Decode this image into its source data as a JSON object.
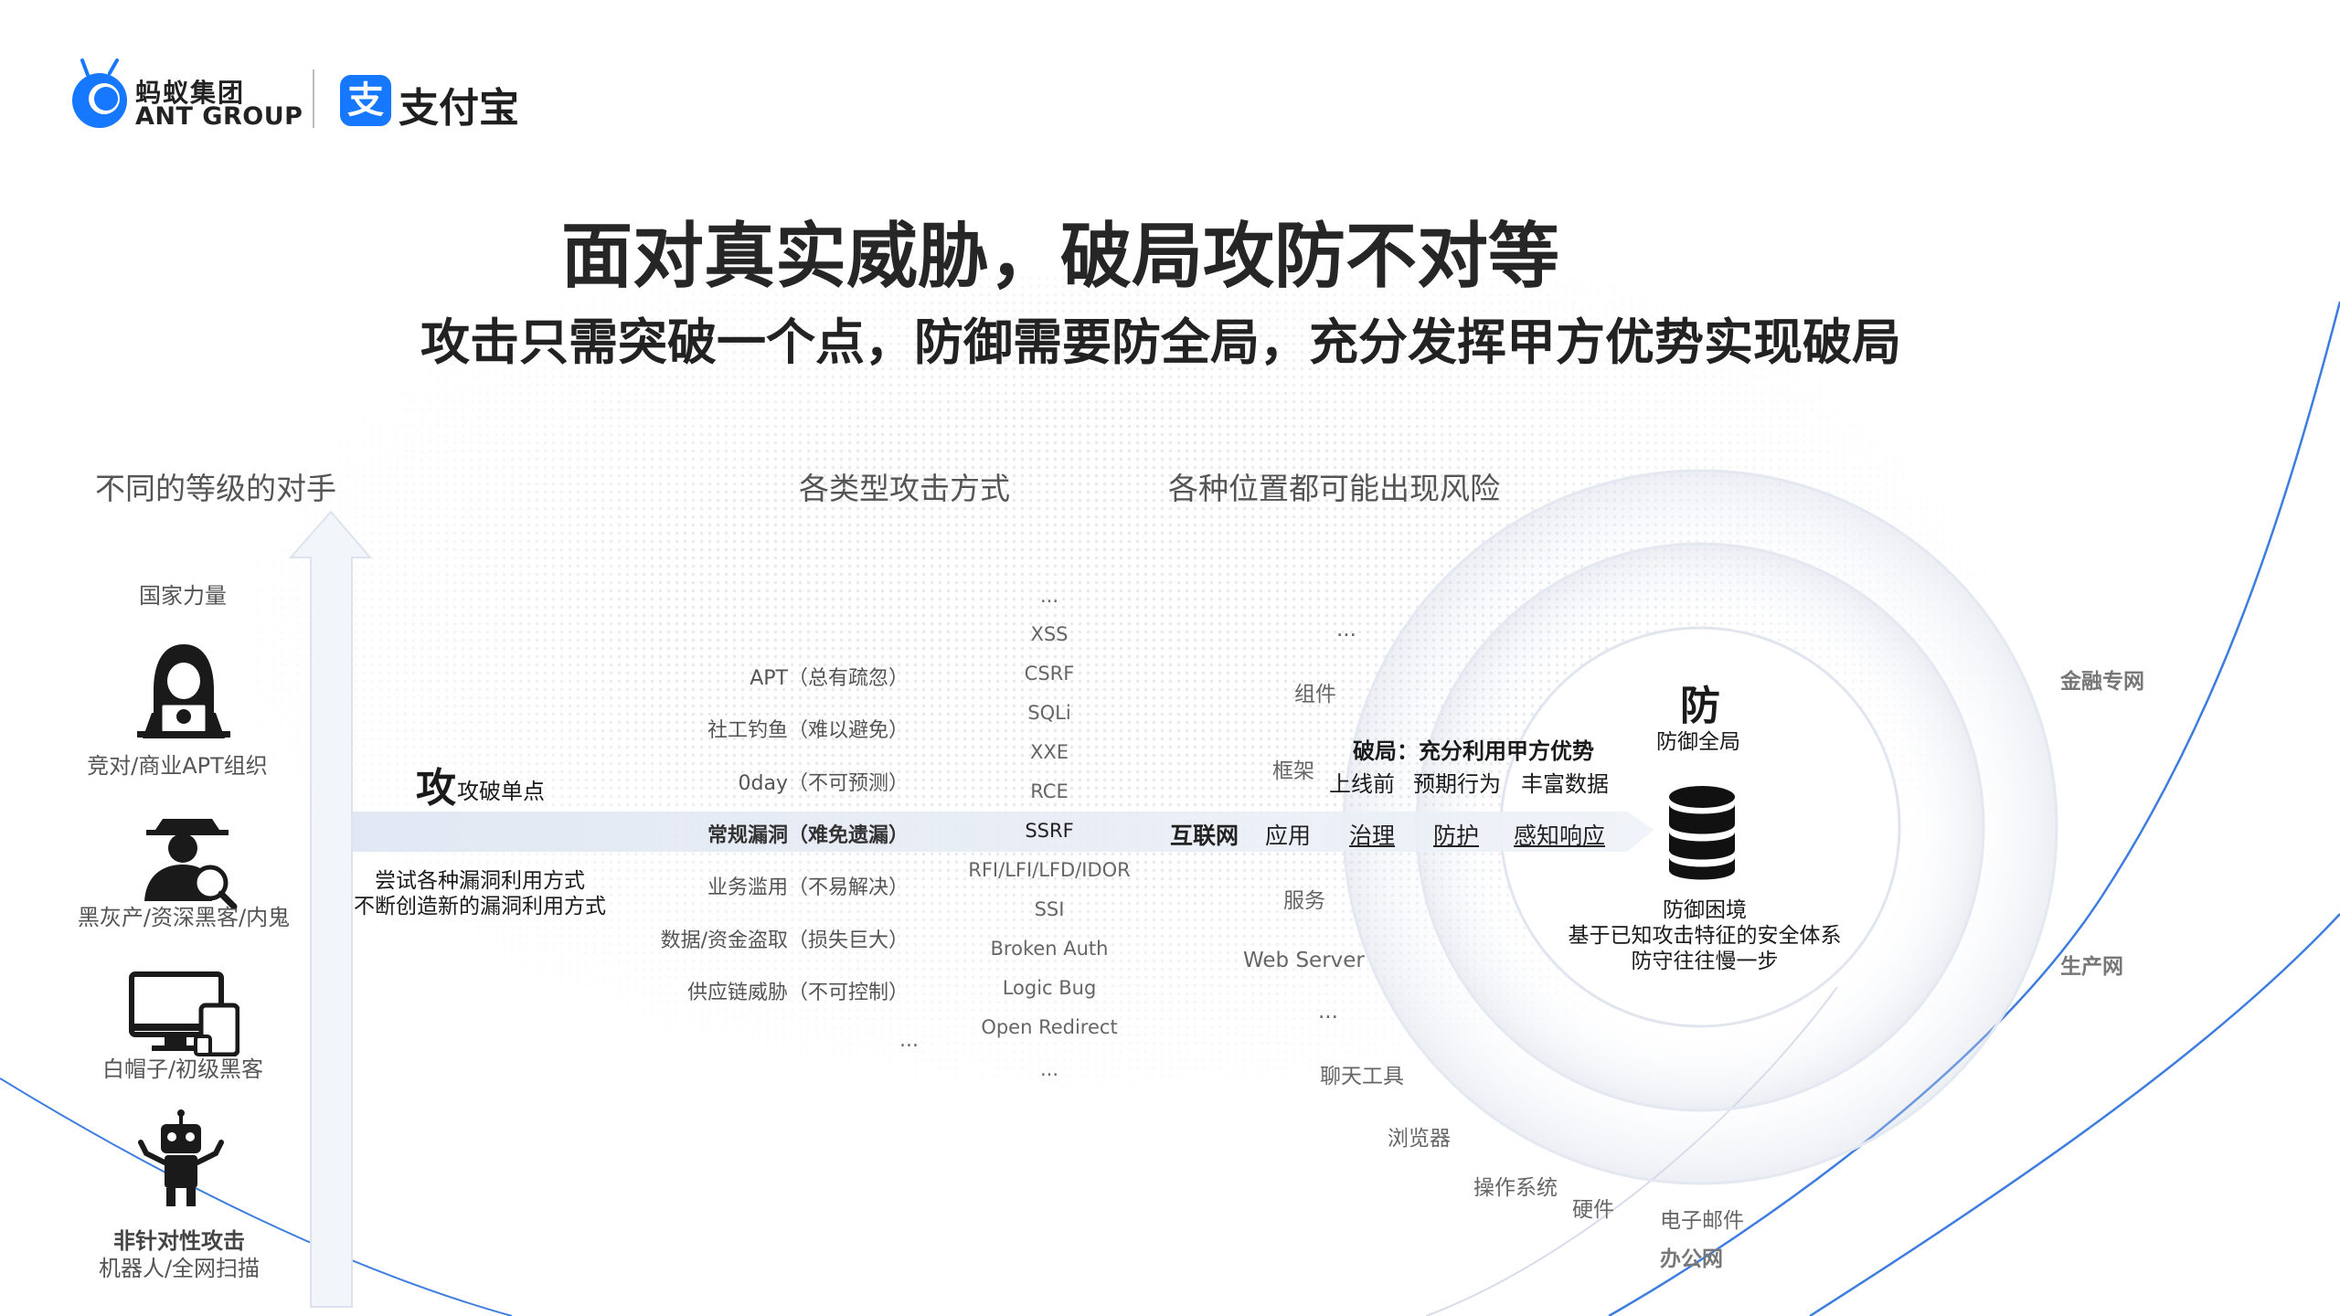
{
  "brand": {
    "ant_cn": "蚂蚁集团",
    "ant_en": "ANT GROUP",
    "alipay_mark": "支",
    "alipay_name": "支付宝"
  },
  "colors": {
    "primary_blue": "#1677ff",
    "arc_blue": "#3d7de0",
    "text_dark": "#262626"
  },
  "headline": {
    "title": "面对真实威胁，破局攻防不对等",
    "subtitle": "攻击只需突破一个点，防御需要防全局，充分发挥甲方优势实现破局"
  },
  "sections": {
    "adversaries": "不同的等级的对手",
    "attack_types": "各类型攻击方式",
    "positions": "各种位置都可能出现风险"
  },
  "adversaries": {
    "level_top": "国家力量",
    "apt": "竞对/商业APT组织",
    "blackhat": "黑灰产/资深黑客/内鬼",
    "whitehat": "白帽子/初级黑客",
    "bot_title": "非针对性攻击",
    "bot_sub": "机器人/全网扫描"
  },
  "icons": {
    "hacker": "hacker-icon",
    "spy": "spy-magnifier-icon",
    "devices": "devices-icon",
    "robot": "robot-icon",
    "database": "database-icon",
    "arrow": "up-arrow-icon"
  },
  "attack": {
    "big_char": "攻",
    "single_point": "攻破单点",
    "note_line1": "尝试各种漏洞利用方式",
    "note_line2": "不断创造新的漏洞利用方式",
    "categories": [
      "APT（总有疏忽）",
      "社工钓鱼（难以避免）",
      "0day（不可预测）",
      "常规漏洞（难免遗漏）",
      "业务滥用（不易解决）",
      "数据/资金盗取（损失巨大）",
      "供应链威胁（不可控制）",
      "..."
    ],
    "vulns": [
      "...",
      "XSS",
      "CSRF",
      "SQLi",
      "XXE",
      "RCE",
      "SSRF",
      "RFI/LFI/LFD/IDOR",
      "SSI",
      "Broken Auth",
      "Logic Bug",
      "Open Redirect",
      "..."
    ]
  },
  "positions": {
    "dots_top": "...",
    "component": "组件",
    "framework": "框架",
    "service": "服务",
    "web_server": "Web Server",
    "dots_mid": "...",
    "chat_tools": "聊天工具",
    "browser": "浏览器",
    "os": "操作系统",
    "hardware": "硬件",
    "email": "电子邮件"
  },
  "zones": {
    "finance": "金融专网",
    "production": "生产网",
    "office": "办公网"
  },
  "flow": {
    "internet": "互联网",
    "app": "应用",
    "govern": "治理",
    "protect": "防护",
    "detect": "感知响应"
  },
  "defense": {
    "breakthrough": "破局：充分利用甲方优势",
    "pre_launch": "上线前",
    "expected_behavior": "预期行为",
    "rich_data": "丰富数据",
    "big_char": "防",
    "global": "防御全局",
    "dilemma_title": "防御困境",
    "dilemma_line1": "基于已知攻击特征的安全体系",
    "dilemma_line2": "防守往往慢一步"
  }
}
